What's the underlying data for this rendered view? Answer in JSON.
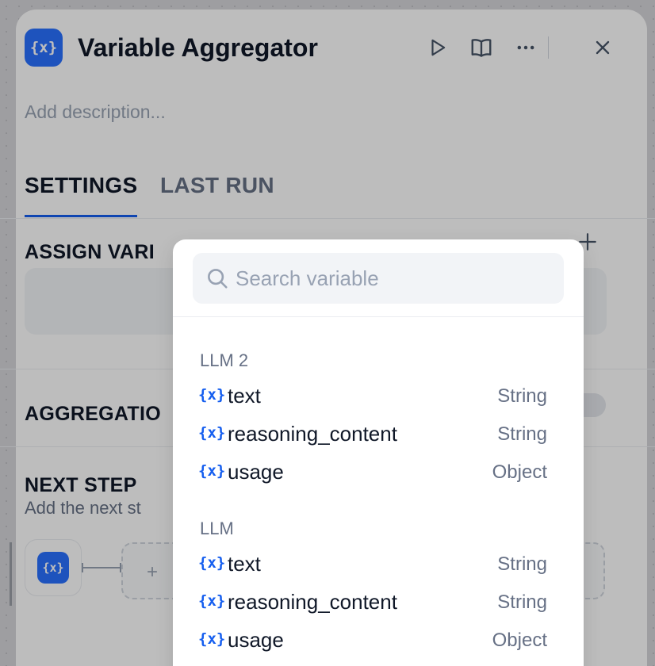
{
  "node": {
    "icon_label": "{x}",
    "title": "Variable Aggregator",
    "description_placeholder": "Add description..."
  },
  "tabs": [
    {
      "label": "SETTINGS",
      "active": true
    },
    {
      "label": "LAST RUN",
      "active": false
    }
  ],
  "sections": {
    "assign_variables": "ASSIGN VARI",
    "aggregation_group": "AGGREGATIO",
    "next_step": "NEXT STEP",
    "next_step_description": "Add the next st"
  },
  "search": {
    "placeholder": "Search variable"
  },
  "variable_groups": [
    {
      "name": "LLM 2",
      "variables": [
        {
          "icon": "{x}",
          "name": "text",
          "type": "String"
        },
        {
          "icon": "{x}",
          "name": "reasoning_content",
          "type": "String"
        },
        {
          "icon": "{x}",
          "name": "usage",
          "type": "Object"
        }
      ]
    },
    {
      "name": "LLM",
      "variables": [
        {
          "icon": "{x}",
          "name": "text",
          "type": "String"
        },
        {
          "icon": "{x}",
          "name": "reasoning_content",
          "type": "String"
        },
        {
          "icon": "{x}",
          "name": "usage",
          "type": "Object"
        }
      ]
    }
  ],
  "colors": {
    "accent": "#155eef",
    "node_icon_bg": "#2970ff",
    "overlay": "rgba(0,0,0,0.26)"
  }
}
